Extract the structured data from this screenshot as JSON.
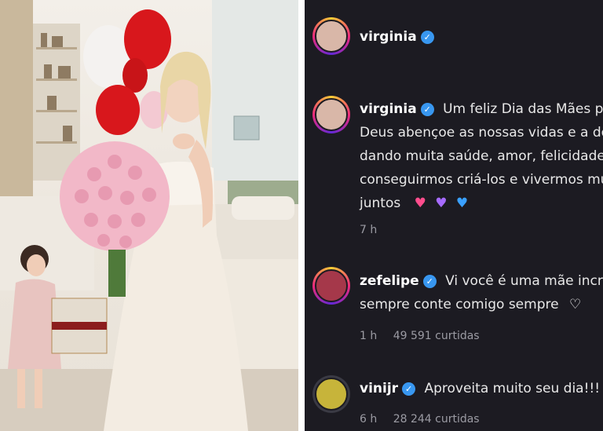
{
  "post_header": {
    "username": "virginia",
    "verified_icon": "verified-badge-icon"
  },
  "comments": [
    {
      "username": "virginia",
      "lines": [
        "Um feliz Dia das Mães para to",
        "Deus abençoe as nossas vidas e a dos n",
        "dando muita saúde, amor, felicidade e s",
        "conseguirmos criá-los e vivermos muito",
        "juntos"
      ],
      "emoji": [
        "pink-heart-icon",
        "purple-heart-icon",
        "blue-heart-icon"
      ],
      "time": "7 h",
      "likes": ""
    },
    {
      "username": "zefelipe",
      "lines": [
        "Vi você é uma mãe incrível D",
        "sempre conte comigo sempre"
      ],
      "emoji": [
        "heart-hands-icon"
      ],
      "time": "1 h",
      "likes": "49 591 curtidas"
    },
    {
      "username": "vinijr",
      "lines": [
        "Aproveita muito seu dia!!! Te an"
      ],
      "time": "6 h",
      "likes": "28 244 curtidas"
    }
  ],
  "colors": {
    "panel_bg": "#1c1b22",
    "verified": "#3897f0",
    "muted": "#9b9ba3",
    "balloon_red": "#d8171c",
    "roses": "#f2b8c8"
  }
}
